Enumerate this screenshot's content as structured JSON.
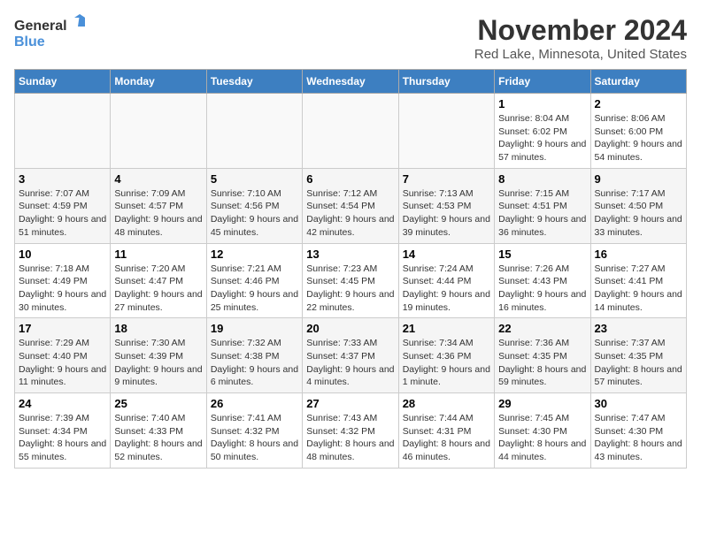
{
  "logo": {
    "line1": "General",
    "line2": "Blue"
  },
  "title": "November 2024",
  "subtitle": "Red Lake, Minnesota, United States",
  "days_of_week": [
    "Sunday",
    "Monday",
    "Tuesday",
    "Wednesday",
    "Thursday",
    "Friday",
    "Saturday"
  ],
  "weeks": [
    [
      {
        "day": "",
        "info": ""
      },
      {
        "day": "",
        "info": ""
      },
      {
        "day": "",
        "info": ""
      },
      {
        "day": "",
        "info": ""
      },
      {
        "day": "",
        "info": ""
      },
      {
        "day": "1",
        "info": "Sunrise: 8:04 AM\nSunset: 6:02 PM\nDaylight: 9 hours and 57 minutes."
      },
      {
        "day": "2",
        "info": "Sunrise: 8:06 AM\nSunset: 6:00 PM\nDaylight: 9 hours and 54 minutes."
      }
    ],
    [
      {
        "day": "3",
        "info": "Sunrise: 7:07 AM\nSunset: 4:59 PM\nDaylight: 9 hours and 51 minutes."
      },
      {
        "day": "4",
        "info": "Sunrise: 7:09 AM\nSunset: 4:57 PM\nDaylight: 9 hours and 48 minutes."
      },
      {
        "day": "5",
        "info": "Sunrise: 7:10 AM\nSunset: 4:56 PM\nDaylight: 9 hours and 45 minutes."
      },
      {
        "day": "6",
        "info": "Sunrise: 7:12 AM\nSunset: 4:54 PM\nDaylight: 9 hours and 42 minutes."
      },
      {
        "day": "7",
        "info": "Sunrise: 7:13 AM\nSunset: 4:53 PM\nDaylight: 9 hours and 39 minutes."
      },
      {
        "day": "8",
        "info": "Sunrise: 7:15 AM\nSunset: 4:51 PM\nDaylight: 9 hours and 36 minutes."
      },
      {
        "day": "9",
        "info": "Sunrise: 7:17 AM\nSunset: 4:50 PM\nDaylight: 9 hours and 33 minutes."
      }
    ],
    [
      {
        "day": "10",
        "info": "Sunrise: 7:18 AM\nSunset: 4:49 PM\nDaylight: 9 hours and 30 minutes."
      },
      {
        "day": "11",
        "info": "Sunrise: 7:20 AM\nSunset: 4:47 PM\nDaylight: 9 hours and 27 minutes."
      },
      {
        "day": "12",
        "info": "Sunrise: 7:21 AM\nSunset: 4:46 PM\nDaylight: 9 hours and 25 minutes."
      },
      {
        "day": "13",
        "info": "Sunrise: 7:23 AM\nSunset: 4:45 PM\nDaylight: 9 hours and 22 minutes."
      },
      {
        "day": "14",
        "info": "Sunrise: 7:24 AM\nSunset: 4:44 PM\nDaylight: 9 hours and 19 minutes."
      },
      {
        "day": "15",
        "info": "Sunrise: 7:26 AM\nSunset: 4:43 PM\nDaylight: 9 hours and 16 minutes."
      },
      {
        "day": "16",
        "info": "Sunrise: 7:27 AM\nSunset: 4:41 PM\nDaylight: 9 hours and 14 minutes."
      }
    ],
    [
      {
        "day": "17",
        "info": "Sunrise: 7:29 AM\nSunset: 4:40 PM\nDaylight: 9 hours and 11 minutes."
      },
      {
        "day": "18",
        "info": "Sunrise: 7:30 AM\nSunset: 4:39 PM\nDaylight: 9 hours and 9 minutes."
      },
      {
        "day": "19",
        "info": "Sunrise: 7:32 AM\nSunset: 4:38 PM\nDaylight: 9 hours and 6 minutes."
      },
      {
        "day": "20",
        "info": "Sunrise: 7:33 AM\nSunset: 4:37 PM\nDaylight: 9 hours and 4 minutes."
      },
      {
        "day": "21",
        "info": "Sunrise: 7:34 AM\nSunset: 4:36 PM\nDaylight: 9 hours and 1 minute."
      },
      {
        "day": "22",
        "info": "Sunrise: 7:36 AM\nSunset: 4:35 PM\nDaylight: 8 hours and 59 minutes."
      },
      {
        "day": "23",
        "info": "Sunrise: 7:37 AM\nSunset: 4:35 PM\nDaylight: 8 hours and 57 minutes."
      }
    ],
    [
      {
        "day": "24",
        "info": "Sunrise: 7:39 AM\nSunset: 4:34 PM\nDaylight: 8 hours and 55 minutes."
      },
      {
        "day": "25",
        "info": "Sunrise: 7:40 AM\nSunset: 4:33 PM\nDaylight: 8 hours and 52 minutes."
      },
      {
        "day": "26",
        "info": "Sunrise: 7:41 AM\nSunset: 4:32 PM\nDaylight: 8 hours and 50 minutes."
      },
      {
        "day": "27",
        "info": "Sunrise: 7:43 AM\nSunset: 4:32 PM\nDaylight: 8 hours and 48 minutes."
      },
      {
        "day": "28",
        "info": "Sunrise: 7:44 AM\nSunset: 4:31 PM\nDaylight: 8 hours and 46 minutes."
      },
      {
        "day": "29",
        "info": "Sunrise: 7:45 AM\nSunset: 4:30 PM\nDaylight: 8 hours and 44 minutes."
      },
      {
        "day": "30",
        "info": "Sunrise: 7:47 AM\nSunset: 4:30 PM\nDaylight: 8 hours and 43 minutes."
      }
    ]
  ]
}
